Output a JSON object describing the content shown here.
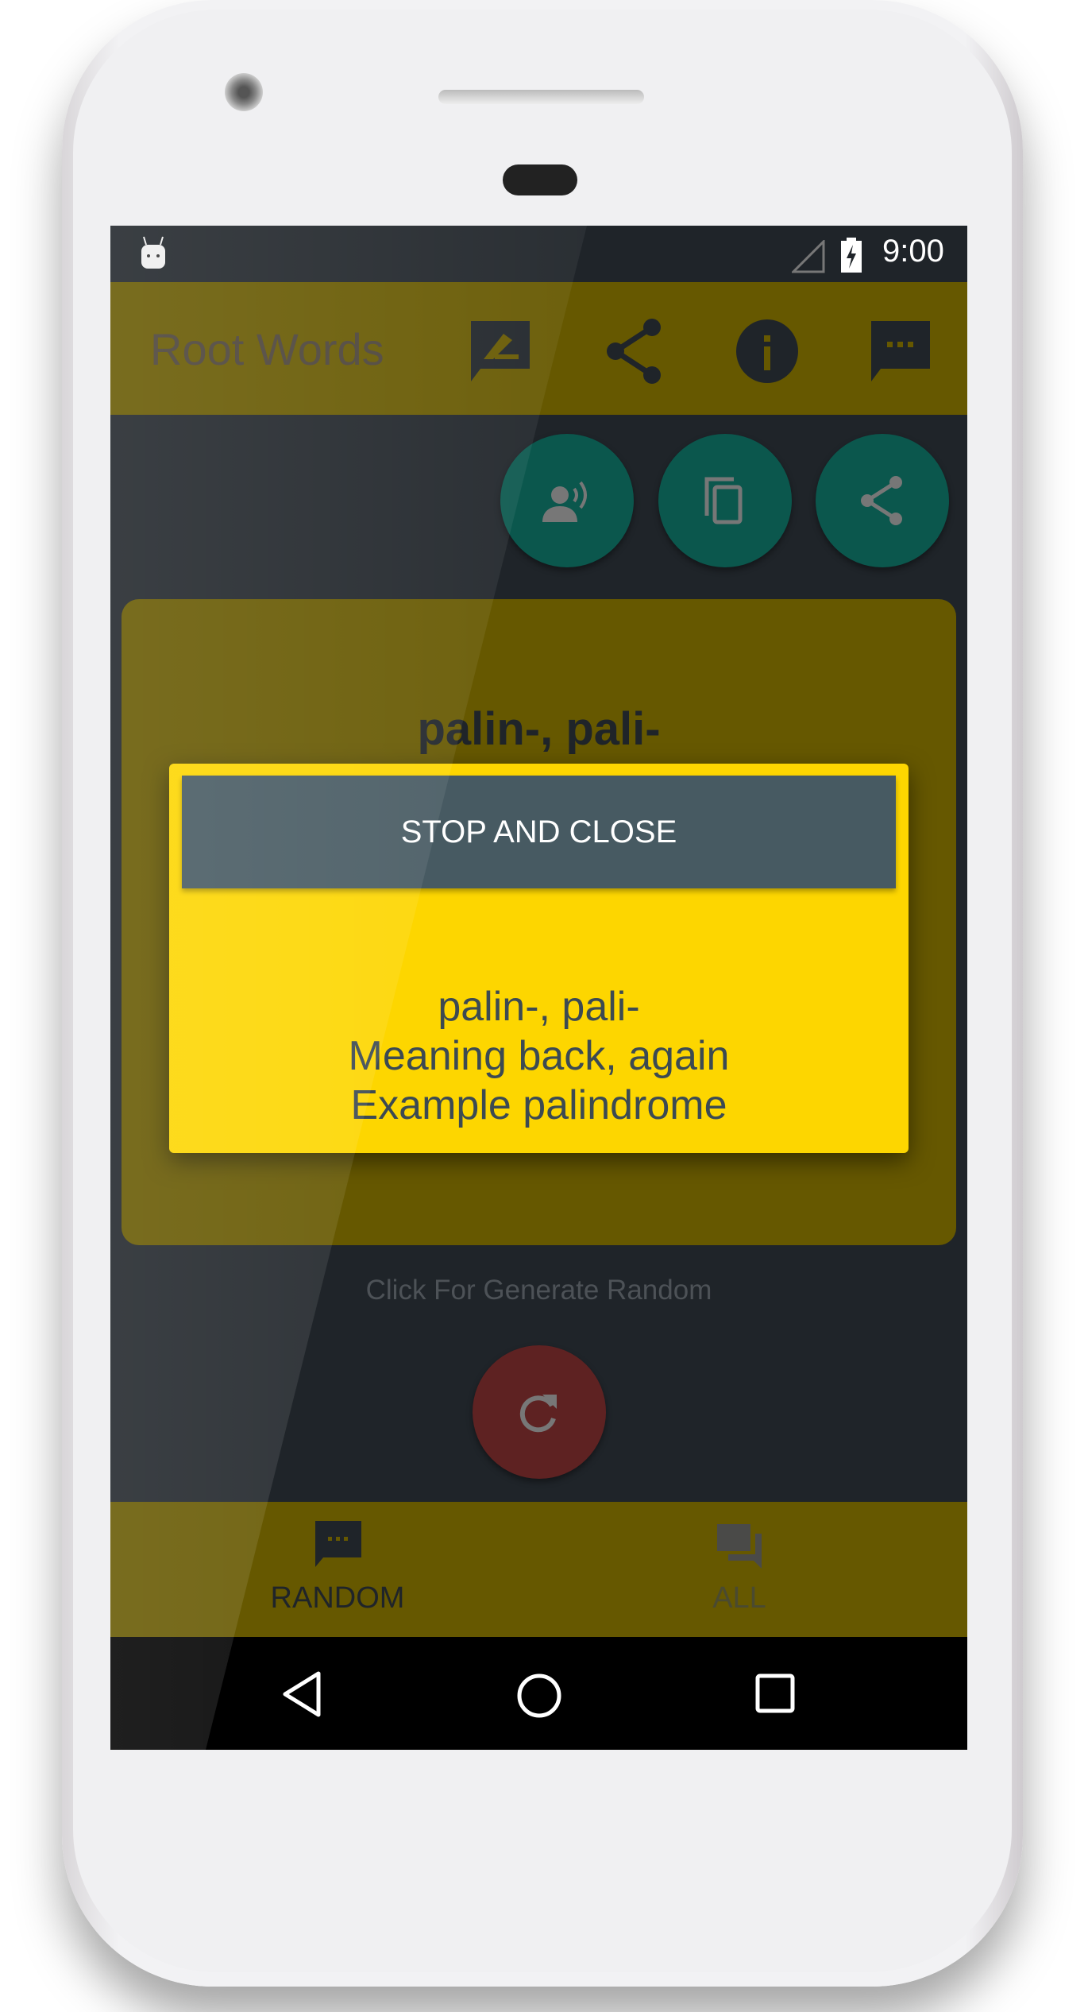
{
  "status_bar": {
    "time": "9:00",
    "icons": [
      "android-icon",
      "signal-icon",
      "battery-charging-icon"
    ]
  },
  "toolbar": {
    "title": "Root Words",
    "actions": [
      "edit-note-icon",
      "share-icon",
      "info-icon",
      "feedback-icon"
    ]
  },
  "fabs": [
    "speak-icon",
    "copy-icon",
    "share-icon"
  ],
  "card": {
    "title": "palin-, pali-"
  },
  "hint": "Click For Generate Random",
  "refresh_icon": "refresh-icon",
  "dialog": {
    "button_label": "STOP AND CLOSE",
    "lines": [
      "palin-, pali-",
      "Meaning back, again",
      "Example palindrome"
    ]
  },
  "bottom_nav": {
    "items": [
      {
        "label": "RANDOM",
        "icon": "chat-icon",
        "active": true
      },
      {
        "label": "ALL",
        "icon": "forum-icon",
        "active": false
      }
    ]
  },
  "colors": {
    "toolbar": "#665800",
    "dialog": "#fdd600",
    "dialog_button": "#475a62",
    "fab": "#0b574d",
    "refresh_fab": "#5e2222",
    "background": "#1f2429"
  }
}
